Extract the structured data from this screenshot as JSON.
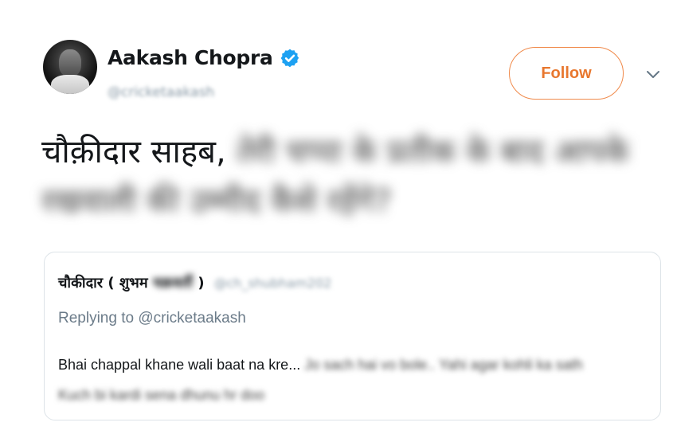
{
  "author": {
    "display_name": "Aakash Chopra",
    "handle": "@cricketaakash",
    "verified": true,
    "verified_color": "#1da1f2"
  },
  "actions": {
    "follow_label": "Follow",
    "accent_color": "#e8772e",
    "menu_icon": "chevron-down-icon"
  },
  "tweet": {
    "visible_text": "चौक़ीदार साहब,",
    "blurred_text": "तेरी चप्पा के प्रतीक के बाद आपके रखवाली की उम्मीद कैसे रहेंगे?"
  },
  "quoted_tweet": {
    "name_prefix": "चौकीदार ( शुभम",
    "name_blurred": "चक्रवर्ती",
    "name_suffix": ")",
    "handle": "@ch_shubham202",
    "reply_to": "Replying to @cricketaakash",
    "body_visible": "Bhai chappal khane wali baat na kre...",
    "body_blurred_1": "Jo sach hai vo bole.. Yahi agar kohli ka sath",
    "body_blurred_2": "Kuch bi kardi sena dhunu hr doo"
  }
}
